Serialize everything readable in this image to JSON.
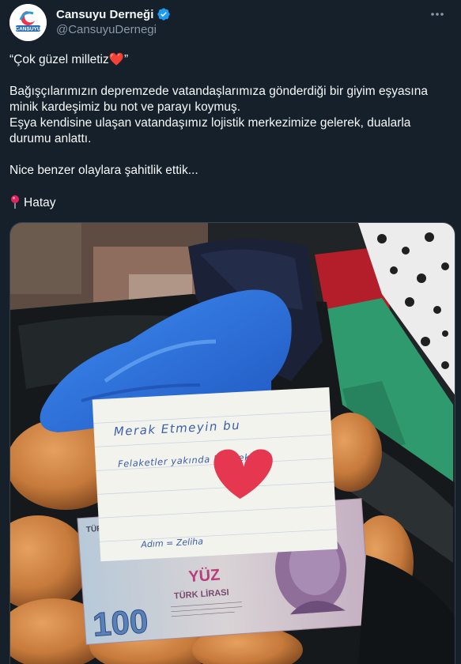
{
  "author": {
    "display_name": "Cansuyu Derneği",
    "handle": "@CansuyuDernegi",
    "verified": true,
    "avatar_text": "CANSUYU"
  },
  "tweet": {
    "line1": "“Çok güzel milletiz❤️”",
    "line2": "Bağışçılarımızın depremzede vatandaşlarımıza gönderdiği bir giyim eşyasına minik kardeşimiz bu not ve parayı koymuş.",
    "line3": "Eşya kendisine ulaşan vatandaşımız lojistik merkezimize gelerek, dualarla durumu anlattı.",
    "line4": "Nice benzer olaylara şahitlik ettik...",
    "location": "Hatay"
  },
  "photo": {
    "note_line1": "Merak Etmeyin bu",
    "note_line2": "Felaketler yakında bitecek",
    "note_signature": "Adım = Zeliha",
    "banknote_value": "100",
    "banknote_yuz": "YÜZ",
    "banknote_lirasi": "TÜRK LİRASI",
    "banknote_turkiye": "TÜRKİYE"
  },
  "icons": {
    "verified": "verified-badge-icon",
    "more": "more-dots-icon",
    "pin": "round-pushpin-icon"
  },
  "colors": {
    "background": "#15202b",
    "text": "#f7f9f9",
    "secondary_text": "#8b98a5",
    "verified_blue": "#1d9bf0",
    "heart_red": "#e0245e"
  }
}
